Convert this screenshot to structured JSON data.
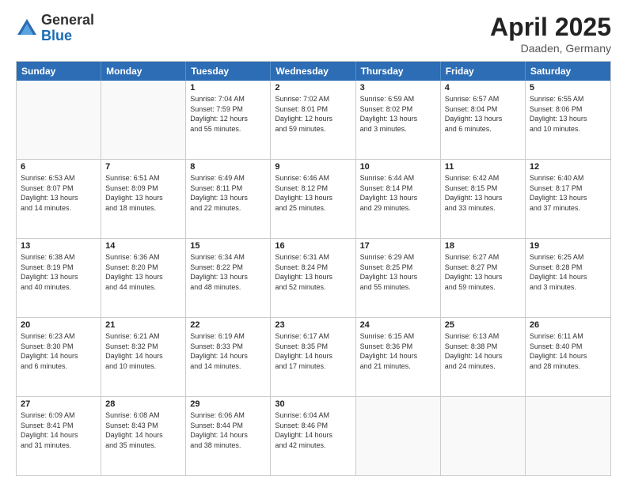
{
  "header": {
    "logo_general": "General",
    "logo_blue": "Blue",
    "month_title": "April 2025",
    "location": "Daaden, Germany"
  },
  "days_of_week": [
    "Sunday",
    "Monday",
    "Tuesday",
    "Wednesday",
    "Thursday",
    "Friday",
    "Saturday"
  ],
  "weeks": [
    [
      {
        "day": "",
        "info": "",
        "empty": true
      },
      {
        "day": "",
        "info": "",
        "empty": true
      },
      {
        "day": "1",
        "info": "Sunrise: 7:04 AM\nSunset: 7:59 PM\nDaylight: 12 hours\nand 55 minutes."
      },
      {
        "day": "2",
        "info": "Sunrise: 7:02 AM\nSunset: 8:01 PM\nDaylight: 12 hours\nand 59 minutes."
      },
      {
        "day": "3",
        "info": "Sunrise: 6:59 AM\nSunset: 8:02 PM\nDaylight: 13 hours\nand 3 minutes."
      },
      {
        "day": "4",
        "info": "Sunrise: 6:57 AM\nSunset: 8:04 PM\nDaylight: 13 hours\nand 6 minutes."
      },
      {
        "day": "5",
        "info": "Sunrise: 6:55 AM\nSunset: 8:06 PM\nDaylight: 13 hours\nand 10 minutes."
      }
    ],
    [
      {
        "day": "6",
        "info": "Sunrise: 6:53 AM\nSunset: 8:07 PM\nDaylight: 13 hours\nand 14 minutes."
      },
      {
        "day": "7",
        "info": "Sunrise: 6:51 AM\nSunset: 8:09 PM\nDaylight: 13 hours\nand 18 minutes."
      },
      {
        "day": "8",
        "info": "Sunrise: 6:49 AM\nSunset: 8:11 PM\nDaylight: 13 hours\nand 22 minutes."
      },
      {
        "day": "9",
        "info": "Sunrise: 6:46 AM\nSunset: 8:12 PM\nDaylight: 13 hours\nand 25 minutes."
      },
      {
        "day": "10",
        "info": "Sunrise: 6:44 AM\nSunset: 8:14 PM\nDaylight: 13 hours\nand 29 minutes."
      },
      {
        "day": "11",
        "info": "Sunrise: 6:42 AM\nSunset: 8:15 PM\nDaylight: 13 hours\nand 33 minutes."
      },
      {
        "day": "12",
        "info": "Sunrise: 6:40 AM\nSunset: 8:17 PM\nDaylight: 13 hours\nand 37 minutes."
      }
    ],
    [
      {
        "day": "13",
        "info": "Sunrise: 6:38 AM\nSunset: 8:19 PM\nDaylight: 13 hours\nand 40 minutes."
      },
      {
        "day": "14",
        "info": "Sunrise: 6:36 AM\nSunset: 8:20 PM\nDaylight: 13 hours\nand 44 minutes."
      },
      {
        "day": "15",
        "info": "Sunrise: 6:34 AM\nSunset: 8:22 PM\nDaylight: 13 hours\nand 48 minutes."
      },
      {
        "day": "16",
        "info": "Sunrise: 6:31 AM\nSunset: 8:24 PM\nDaylight: 13 hours\nand 52 minutes."
      },
      {
        "day": "17",
        "info": "Sunrise: 6:29 AM\nSunset: 8:25 PM\nDaylight: 13 hours\nand 55 minutes."
      },
      {
        "day": "18",
        "info": "Sunrise: 6:27 AM\nSunset: 8:27 PM\nDaylight: 13 hours\nand 59 minutes."
      },
      {
        "day": "19",
        "info": "Sunrise: 6:25 AM\nSunset: 8:28 PM\nDaylight: 14 hours\nand 3 minutes."
      }
    ],
    [
      {
        "day": "20",
        "info": "Sunrise: 6:23 AM\nSunset: 8:30 PM\nDaylight: 14 hours\nand 6 minutes."
      },
      {
        "day": "21",
        "info": "Sunrise: 6:21 AM\nSunset: 8:32 PM\nDaylight: 14 hours\nand 10 minutes."
      },
      {
        "day": "22",
        "info": "Sunrise: 6:19 AM\nSunset: 8:33 PM\nDaylight: 14 hours\nand 14 minutes."
      },
      {
        "day": "23",
        "info": "Sunrise: 6:17 AM\nSunset: 8:35 PM\nDaylight: 14 hours\nand 17 minutes."
      },
      {
        "day": "24",
        "info": "Sunrise: 6:15 AM\nSunset: 8:36 PM\nDaylight: 14 hours\nand 21 minutes."
      },
      {
        "day": "25",
        "info": "Sunrise: 6:13 AM\nSunset: 8:38 PM\nDaylight: 14 hours\nand 24 minutes."
      },
      {
        "day": "26",
        "info": "Sunrise: 6:11 AM\nSunset: 8:40 PM\nDaylight: 14 hours\nand 28 minutes."
      }
    ],
    [
      {
        "day": "27",
        "info": "Sunrise: 6:09 AM\nSunset: 8:41 PM\nDaylight: 14 hours\nand 31 minutes."
      },
      {
        "day": "28",
        "info": "Sunrise: 6:08 AM\nSunset: 8:43 PM\nDaylight: 14 hours\nand 35 minutes."
      },
      {
        "day": "29",
        "info": "Sunrise: 6:06 AM\nSunset: 8:44 PM\nDaylight: 14 hours\nand 38 minutes."
      },
      {
        "day": "30",
        "info": "Sunrise: 6:04 AM\nSunset: 8:46 PM\nDaylight: 14 hours\nand 42 minutes."
      },
      {
        "day": "",
        "info": "",
        "empty": true
      },
      {
        "day": "",
        "info": "",
        "empty": true
      },
      {
        "day": "",
        "info": "",
        "empty": true
      }
    ]
  ]
}
